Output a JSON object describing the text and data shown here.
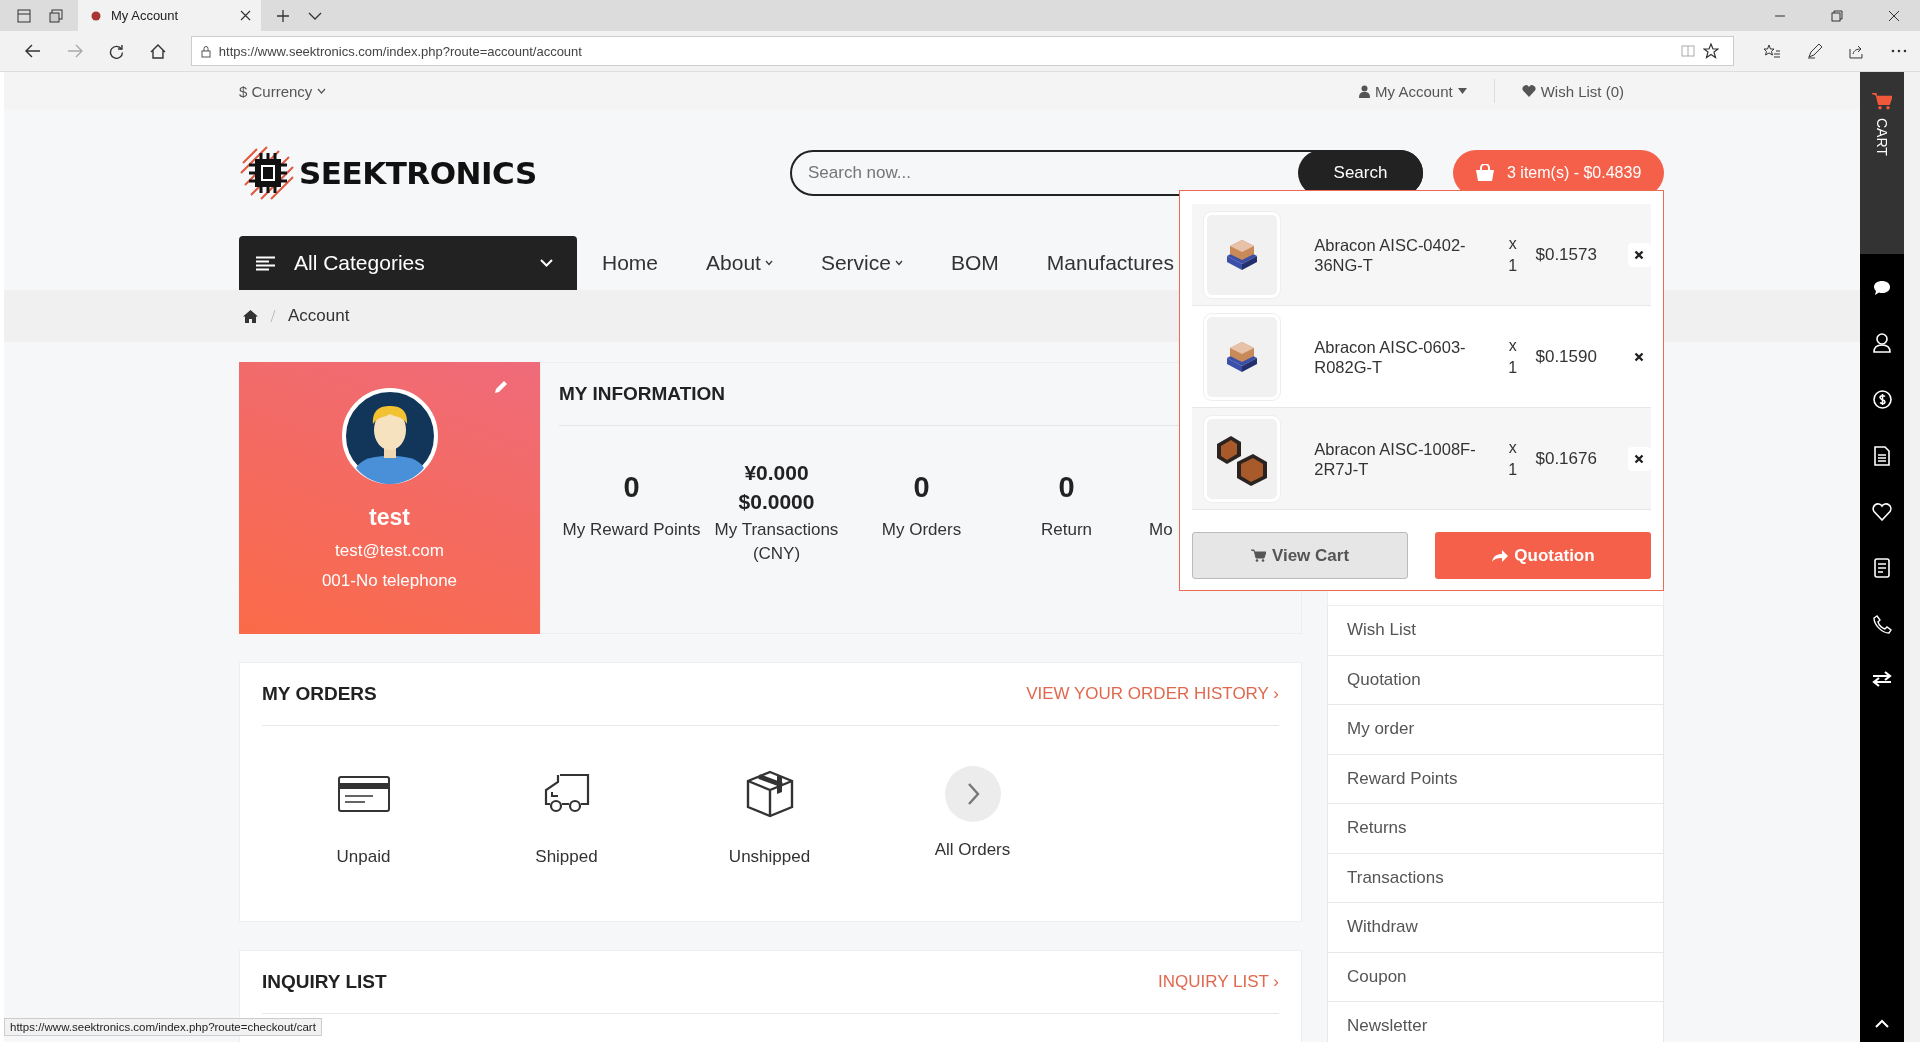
{
  "browser": {
    "tab_title": "My Account",
    "url": "https://www.seektronics.com/index.php?route=account/account",
    "status_url": "https://www.seektronics.com/index.php?route=checkout/cart"
  },
  "topbar": {
    "currency": "$ Currency",
    "my_account": "My Account",
    "wish_list": "Wish List (0)"
  },
  "header": {
    "logo": "SEEKTRONICS",
    "search": {
      "placeholder": "Search now...",
      "button": "Search"
    },
    "cart_button": "3 item(s) - $0.4839"
  },
  "nav": {
    "categories": "All Categories",
    "items": [
      {
        "label": "Home",
        "dropdown": false
      },
      {
        "label": "About",
        "dropdown": true
      },
      {
        "label": "Service",
        "dropdown": true
      },
      {
        "label": "BOM",
        "dropdown": false
      },
      {
        "label": "Manufactures",
        "dropdown": false
      }
    ]
  },
  "breadcrumb": [
    "Account"
  ],
  "profile": {
    "name": "test",
    "email": "test@test.com",
    "phone": "001-No telephone"
  },
  "my_information": {
    "title": "MY INFORMATION",
    "stats": [
      {
        "values": [
          "0"
        ],
        "label": "My Reward Points"
      },
      {
        "values": [
          "¥0.000",
          "$0.0000"
        ],
        "label": "My Transactions (CNY)"
      },
      {
        "values": [
          "0"
        ],
        "label": "My Orders"
      },
      {
        "values": [
          "0"
        ],
        "label": "Return"
      }
    ],
    "cut_label": "Mo"
  },
  "my_orders": {
    "title": "MY ORDERS",
    "link": "VIEW YOUR ORDER HISTORY ›",
    "items": [
      {
        "kind": "unpaid",
        "label": "Unpaid"
      },
      {
        "kind": "shipped",
        "label": "Shipped"
      },
      {
        "kind": "unshipped",
        "label": "Unshipped"
      },
      {
        "kind": "all",
        "label": "All Orders"
      }
    ]
  },
  "inquiry": {
    "title": "INQUIRY LIST",
    "link": "INQUIRY LIST ›"
  },
  "account_menu": [
    "Wish List",
    "Quotation",
    "My order",
    "Reward Points",
    "Returns",
    "Transactions",
    "Withdraw",
    "Coupon",
    "Newsletter"
  ],
  "cart_dropdown": {
    "items": [
      {
        "name": "Abracon AISC-0402-36NG-T",
        "qty_prefix": "x",
        "qty": "1",
        "price": "$0.1573",
        "kind": "picture"
      },
      {
        "name": "Abracon AISC-0603-R082G-T",
        "qty_prefix": "x",
        "qty": "1",
        "price": "$0.1590",
        "kind": "picture"
      },
      {
        "name": "Abracon AISC-1008F-2R7J-T",
        "qty_prefix": "x",
        "qty": "1",
        "price": "$0.1676",
        "kind": "picture"
      }
    ],
    "view_cart": "View Cart",
    "quotation": "Quotation"
  },
  "side_toolbar": {
    "cart_label": "CART"
  }
}
